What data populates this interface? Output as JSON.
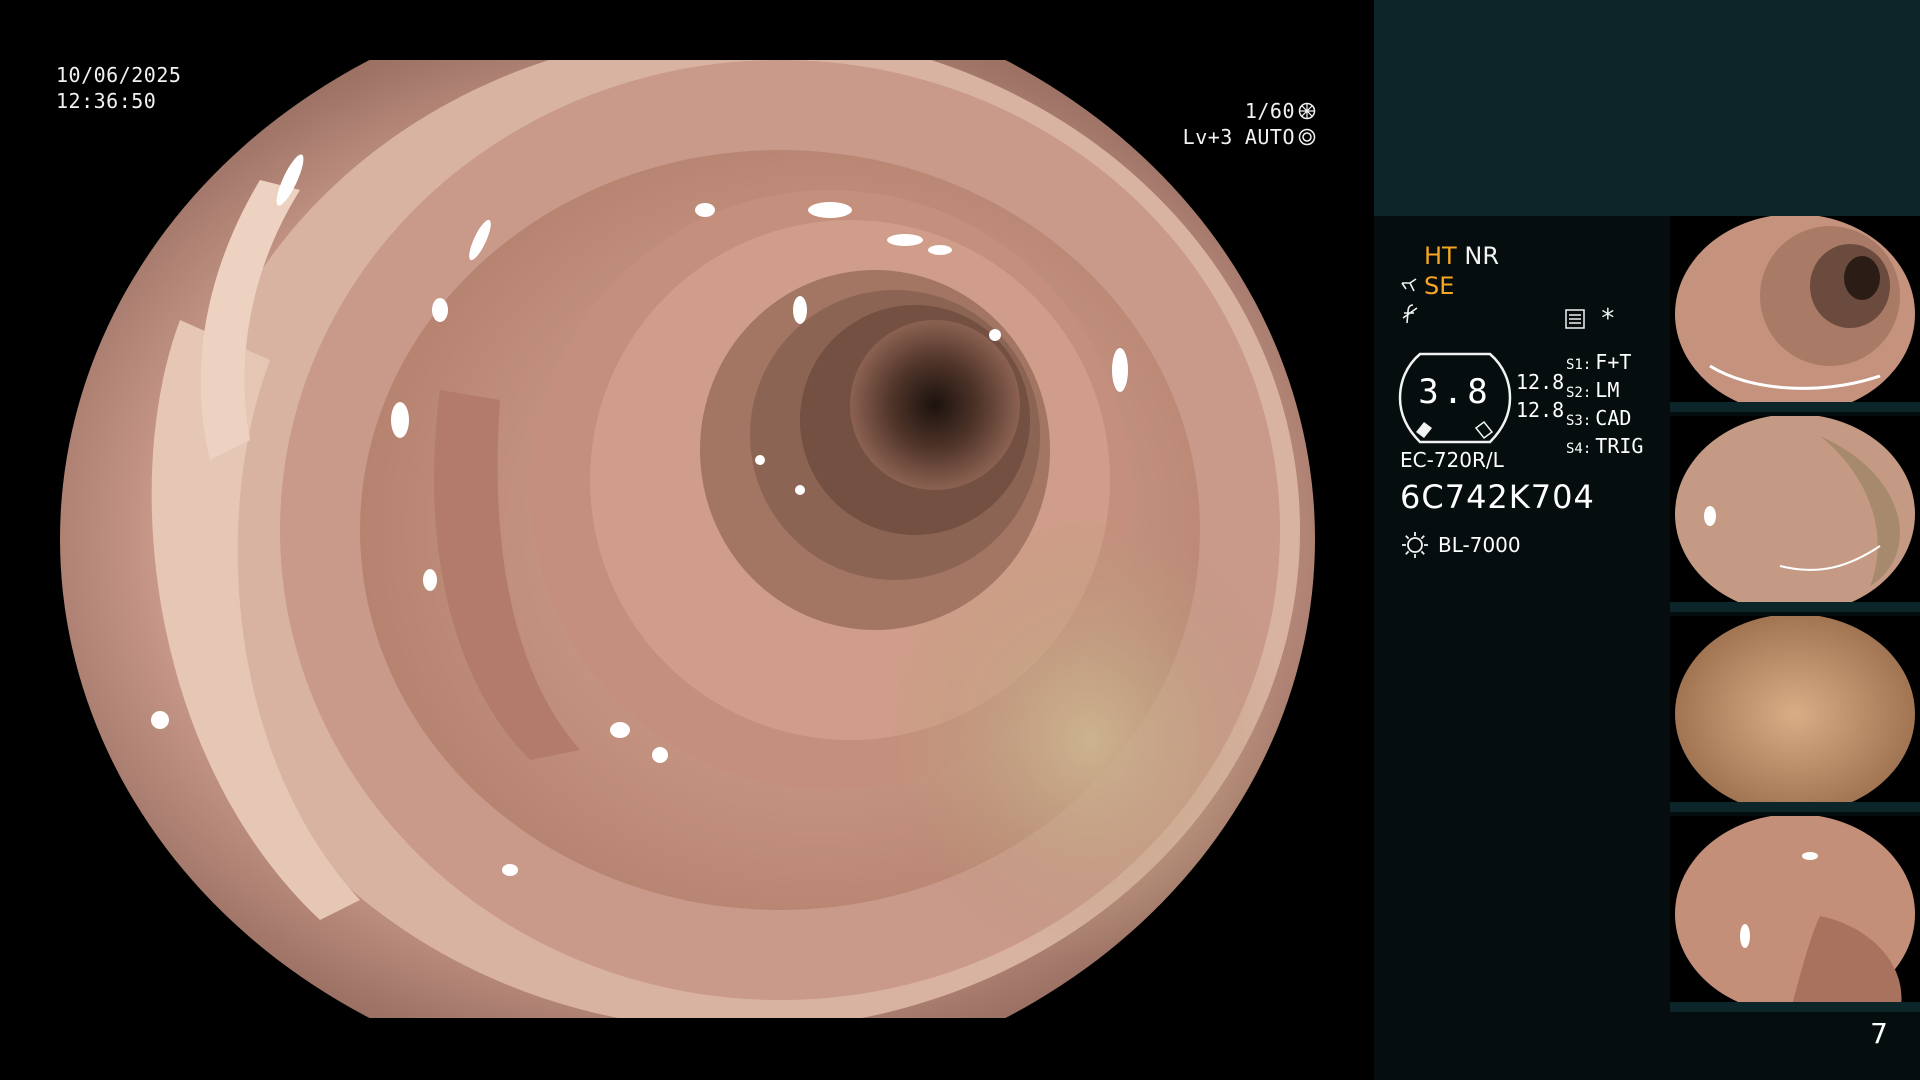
{
  "overlay": {
    "date": "10/06/2025",
    "time": "12:36:50",
    "shutter": "1/60",
    "level": "Lv+3",
    "iris": "AUTO"
  },
  "panel": {
    "mode_ht": "HT",
    "mode_nr": "NR",
    "mode_se": "SE",
    "gauge_value": "3.8",
    "gauge_sub_1": "12.8",
    "gauge_sub_2": "12.8",
    "switches": [
      {
        "key": "S1:",
        "value": "F+T"
      },
      {
        "key": "S2:",
        "value": "LM"
      },
      {
        "key": "S3:",
        "value": "CAD"
      },
      {
        "key": "S4:",
        "value": "TRIG"
      }
    ],
    "scope_model": "EC-720R/L",
    "scope_serial": "6C742K704",
    "light_source": "BL-7000",
    "asterisk": "*"
  },
  "page_number": "7",
  "colors": {
    "accent": "#f5a623",
    "panel_bg": "#050d0e",
    "panel_top": "#0b2528",
    "mucosa": "#c99483"
  },
  "icons": [
    "shutter-icon",
    "iris-icon",
    "scissors-se-icon",
    "f-slash-icon",
    "settings-icon",
    "light-source-icon"
  ]
}
